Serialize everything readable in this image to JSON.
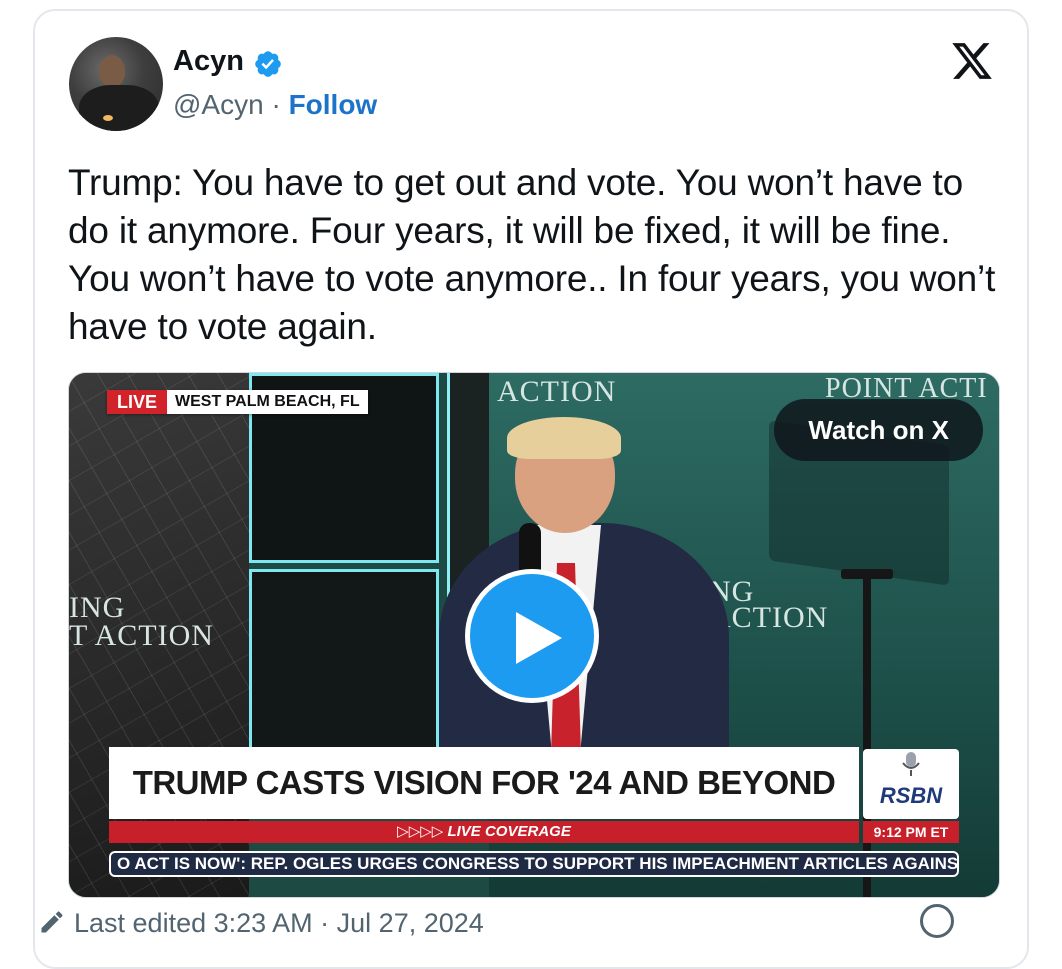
{
  "tweet": {
    "author_name": "Acyn",
    "handle": "@Acyn",
    "separator": " · ",
    "follow_label": "Follow",
    "text": "Trump: You have to get out and vote. You won’t have to do it anymore. Four years, it will be fixed, it will be fine. You won’t have to vote anymore.. In four years, you won’t have to vote again.",
    "footer_text": "Last edited 3:23 AM · Jul 27, 2024"
  },
  "video": {
    "live_badge": "LIVE",
    "location": "WEST PALM BEACH, FL",
    "watch_label": "Watch on X",
    "headline": "TRUMP CASTS VISION FOR '24 AND BEYOND",
    "live_coverage": "▷▷▷▷ LIVE COVERAGE",
    "ticker": "O ACT IS NOW': REP. OGLES URGES CONGRESS TO SUPPORT HIS IMPEACHMENT ARTICLES AGAINS",
    "network": "RSBN",
    "time": "9:12 PM ET",
    "backdrop_texts": {
      "top_center": "ACTION",
      "top_right": "POINT ACTI",
      "left_1": "ING",
      "left_2": "T ACTION",
      "center_1": "NG",
      "center_2": "ACTION"
    }
  },
  "colors": {
    "follow": "#1d73c9",
    "verified": "#1d9bf0",
    "live_red": "#d2232a",
    "play": "#1d9bf0"
  },
  "icons": [
    "verified-badge-icon",
    "x-logo-icon",
    "play-icon",
    "pencil-icon",
    "info-icon"
  ]
}
